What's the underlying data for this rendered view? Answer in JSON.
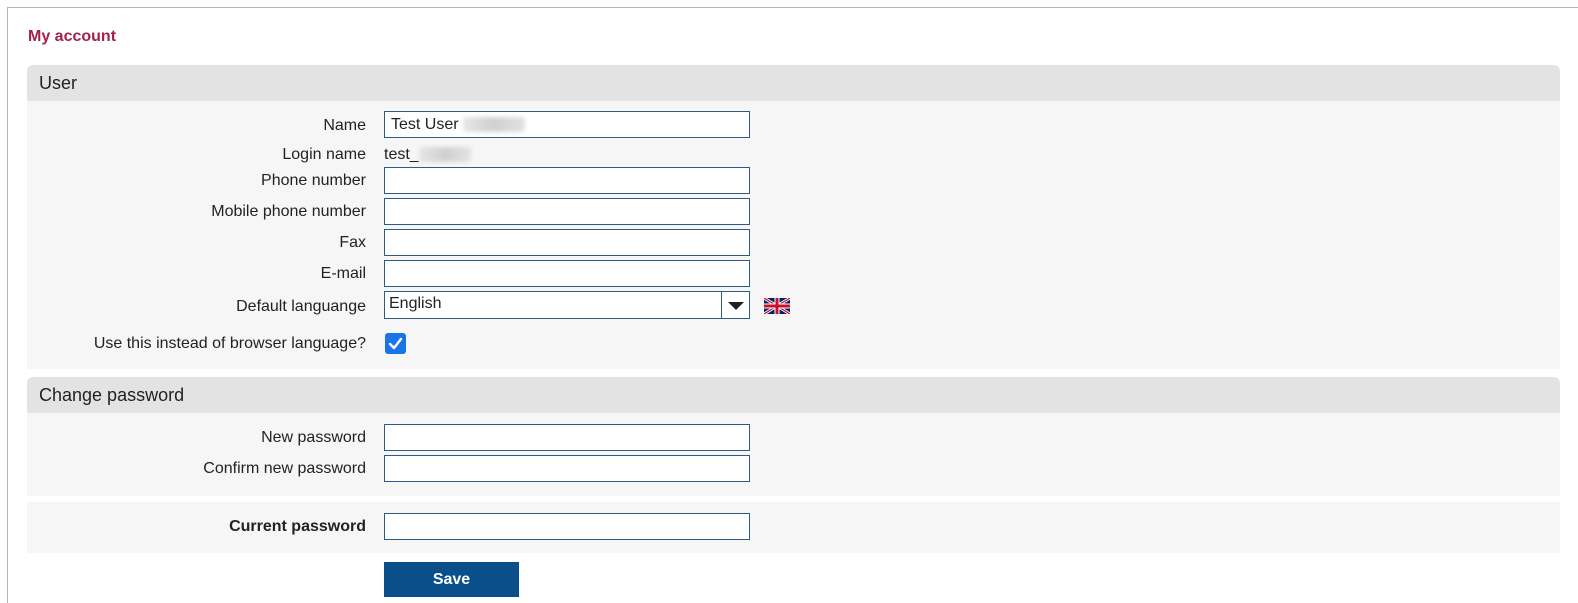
{
  "page": {
    "title": "My account"
  },
  "user_section": {
    "header": "User",
    "name_label": "Name",
    "name_value": "Test User",
    "login_label": "Login name",
    "login_value": "test_",
    "phone_label": "Phone number",
    "phone_value": "",
    "mobile_label": "Mobile phone number",
    "mobile_value": "",
    "fax_label": "Fax",
    "fax_value": "",
    "email_label": "E-mail",
    "email_value": "",
    "language_label": "Default languange",
    "language_value": "English",
    "language_flag_icon": "uk-flag-icon",
    "browser_lang_label": "Use this instead of browser language?",
    "browser_lang_checked": true
  },
  "password_section": {
    "header": "Change password",
    "new_password_label": "New password",
    "confirm_password_label": "Confirm new password"
  },
  "current_password": {
    "label": "Current password"
  },
  "actions": {
    "save_label": "Save"
  },
  "colors": {
    "title": "#a3214a",
    "section_header_bg": "#e3e3e3",
    "section_body_bg": "#f6f6f6",
    "input_border": "#2d5a86",
    "save_button_bg": "#0b4f8a",
    "checkbox_bg": "#1a73e8"
  }
}
